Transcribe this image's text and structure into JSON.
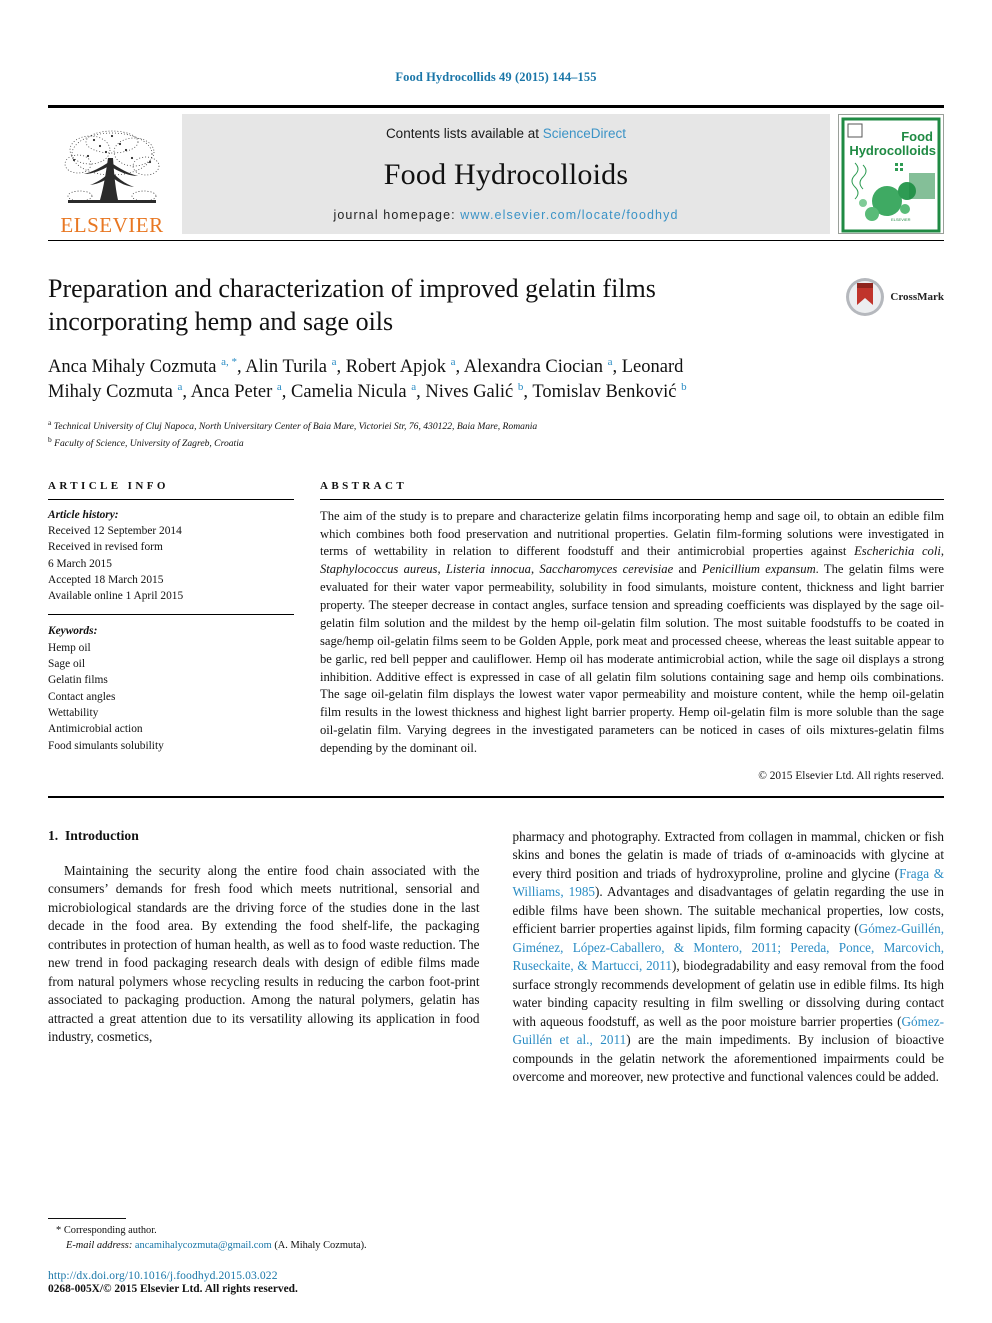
{
  "running_head": "Food Hydrocollids 49 (2015) 144–155",
  "header": {
    "contents_prefix": "Contents lists available at ",
    "sciencedirect": "ScienceDirect",
    "journal_name": "Food Hydrocolloids",
    "homepage_prefix": "journal homepage: ",
    "homepage_url": "www.elsevier.com/locate/foodhyd",
    "publisher": "ELSEVIER",
    "cover_title_line1": "Food",
    "cover_title_line2": "Hydrocolloids",
    "accent_link": "#3b93c6",
    "publisher_orange": "#E87722",
    "cover_green": "#1f8a43"
  },
  "crossmark": {
    "label": "CrossMark"
  },
  "article": {
    "title": "Preparation and characterization of improved gelatin films incorporating hemp and sage oils",
    "authors": [
      {
        "name": "Anca Mihaly Cozmuta",
        "marks": "a, *"
      },
      {
        "name": "Alin Turila",
        "marks": "a"
      },
      {
        "name": "Robert Apjok",
        "marks": "a"
      },
      {
        "name": "Alexandra Ciocian",
        "marks": "a"
      },
      {
        "name": "Leonard Mihaly Cozmuta",
        "marks": "a"
      },
      {
        "name": "Anca Peter",
        "marks": "a"
      },
      {
        "name": "Camelia Nicula",
        "marks": "a"
      },
      {
        "name": "Nives Galić",
        "marks": "b"
      },
      {
        "name": "Tomislav Benković",
        "marks": "b"
      }
    ],
    "affiliations": [
      {
        "mark": "a",
        "text": "Technical University of Cluj Napoca, North Universitary Center of Baia Mare, Victoriei Str, 76, 430122, Baia Mare, Romania"
      },
      {
        "mark": "b",
        "text": "Faculty of Science, University of Zagreb, Croatia"
      }
    ]
  },
  "article_info": {
    "heading": "ARTICLE INFO",
    "history_label": "Article history:",
    "history": [
      "Received 12 September 2014",
      "Received in revised form",
      "6 March 2015",
      "Accepted 18 March 2015",
      "Available online 1 April 2015"
    ],
    "keywords_label": "Keywords:",
    "keywords": [
      "Hemp oil",
      "Sage oil",
      "Gelatin films",
      "Contact angles",
      "Wettability",
      "Antimicrobial action",
      "Food simulants solubility"
    ]
  },
  "abstract": {
    "heading": "ABSTRACT",
    "p1": "The aim of the study is to prepare and characterize gelatin films incorporating hemp and sage oil, to obtain an edible film which combines both food preservation and nutritional properties. Gelatin film-forming solutions were investigated in terms of wettability in relation to different foodstuff and their antimicrobial properties against ",
    "sp1": "Escherichia coli",
    "mid1": ", ",
    "sp2": "Staphylococcus aureus",
    "mid2": ", ",
    "sp3": "Listeria innocua",
    "mid3": ", ",
    "sp4": "Saccharomyces cerevisiae",
    "mid4": " and ",
    "sp5": "Penicillium expansum",
    "p2": ". The gelatin films were evaluated for their water vapor permeability, solubility in food simulants, moisture content, thickness and light barrier property. The steeper decrease in contact angles, surface tension and spreading coefficients was displayed by the sage oil-gelatin film solution and the mildest by the hemp oil-gelatin film solution. The most suitable foodstuffs to be coated in sage/hemp oil-gelatin films seem to be Golden Apple, pork meat and processed cheese, whereas the least suitable appear to be garlic, red bell pepper and cauliflower. Hemp oil has moderate antimicrobial action, while the sage oil displays a strong inhibition. Additive effect is expressed in case of all gelatin film solutions containing sage and hemp oils combinations. The sage oil-gelatin film displays the lowest water vapor permeability and moisture content, while the hemp oil-gelatin film results in the lowest thickness and highest light barrier property. Hemp oil-gelatin film is more soluble than the sage oil-gelatin film. Varying degrees in the investigated parameters can be noticed in cases of oils mixtures-gelatin films depending by the dominant oil.",
    "copyright": "© 2015 Elsevier Ltd. All rights reserved."
  },
  "introduction": {
    "section_number": "1.",
    "section_title": "Introduction",
    "left_p1": "Maintaining the security along the entire food chain associated with the consumers’ demands for fresh food which meets nutritional, sensorial and microbiological standards are the driving force of the studies done in the last decade in the food area. By extending the food shelf-life, the packaging contributes in protection of human health, as well as to food waste reduction. The new trend in food packaging research deals with design of edible films made from natural polymers whose recycling results in reducing the carbon foot-print associated to packaging production. Among the natural polymers, gelatin has attracted a great attention due to its versatility allowing its application in food industry, cosmetics,",
    "right_part1": "pharmacy and photography. Extracted from collagen in mammal, chicken or fish skins and bones the gelatin is made of triads of α-aminoacids with glycine at every third position and triads of hydroxyproline, proline and glycine (",
    "right_ref1": "Fraga & Williams, 1985",
    "right_part2": "). Advantages and disadvantages of gelatin regarding the use in edible films have been shown. The suitable mechanical properties, low costs, efficient barrier properties against lipids, film forming capacity (",
    "right_ref2": "Gómez-Guillén, Giménez, López-Caballero, & Montero, 2011; Pereda, Ponce, Marcovich, Ruseckaite, & Martucci, 2011",
    "right_part3": "), biodegradability and easy removal from the food surface strongly recommends development of gelatin use in edible films. Its high water binding capacity resulting in film swelling or dissolving during contact with aqueous foodstuff, as well as the poor moisture barrier properties (",
    "right_ref3": "Gómez-Guillén et al., 2011",
    "right_part4": ") are the main impediments. By inclusion of bioactive compounds in the gelatin network the aforementioned impairments could be overcome and moreover, new protective and functional valences could be added."
  },
  "footer": {
    "corresponding_author": "Corresponding author.",
    "email_label": "E-mail address:",
    "email": "ancamihalycozmuta@gmail.com",
    "email_suffix": "(A. Mihaly Cozmuta).",
    "doi": "http://dx.doi.org/10.1016/j.foodhyd.2015.03.022",
    "issn_line": "0268-005X/© 2015 Elsevier Ltd. All rights reserved."
  }
}
